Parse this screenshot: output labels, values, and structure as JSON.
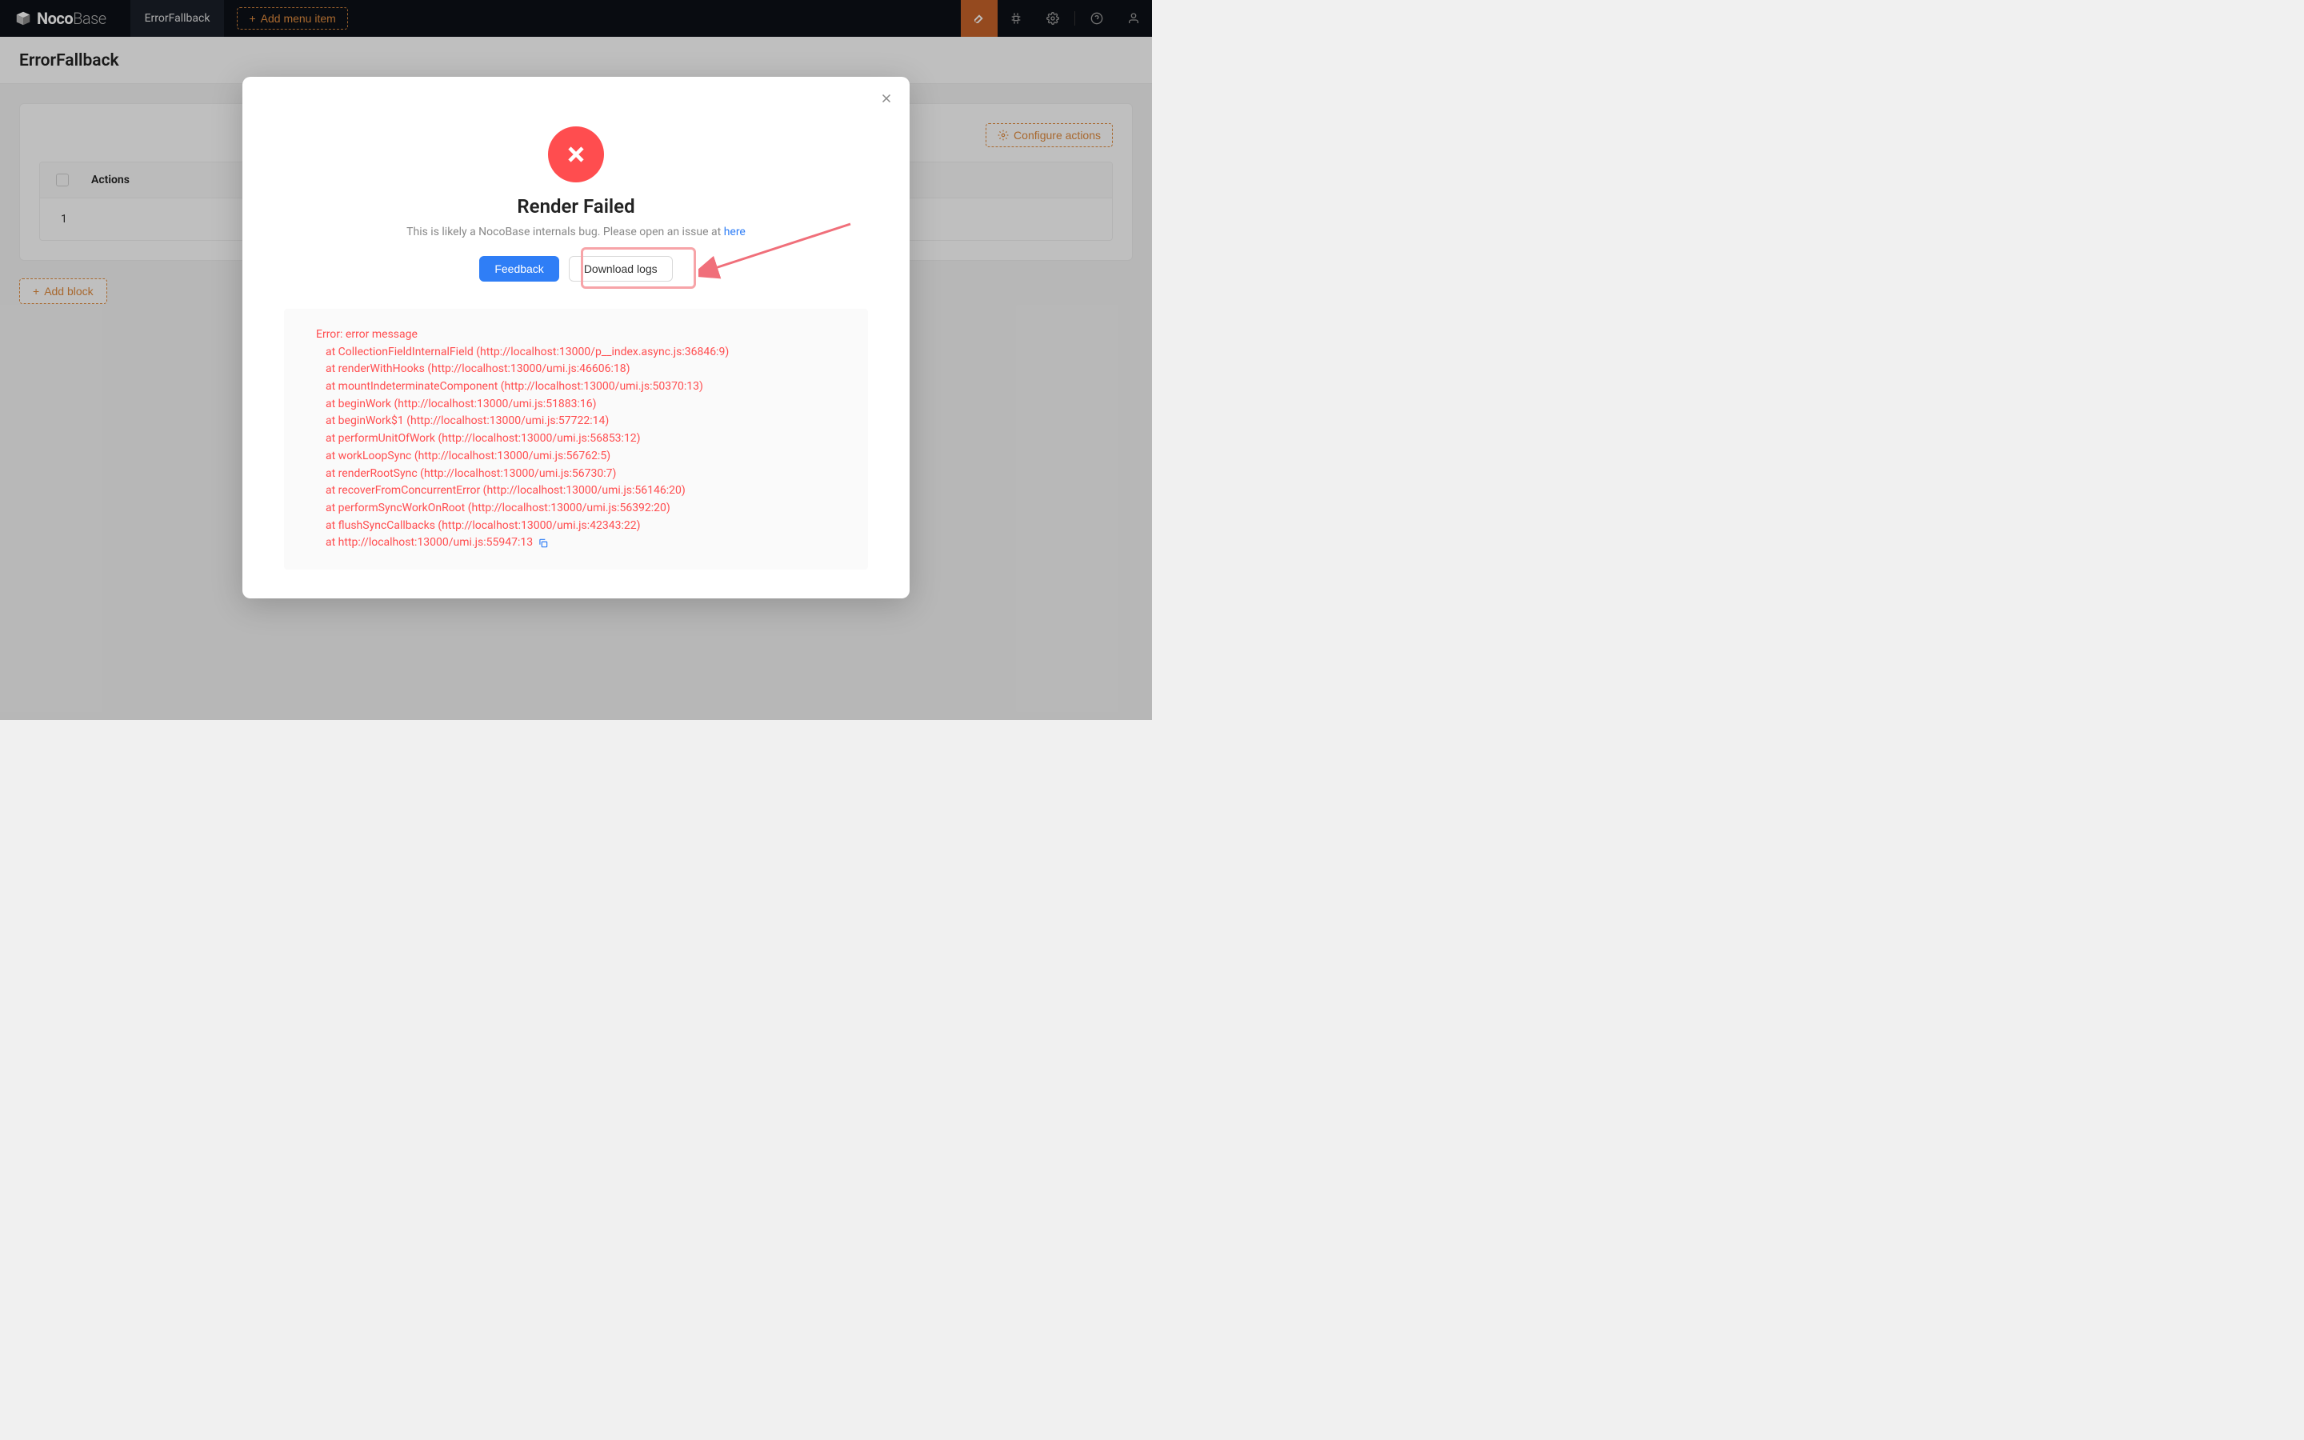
{
  "header": {
    "brand_bold": "Noco",
    "brand_light": "Base",
    "nav_item": "ErrorFallback",
    "add_menu": "Add menu item"
  },
  "page": {
    "title": "ErrorFallback",
    "configure_actions": "Configure actions",
    "actions_col": "Actions",
    "row_num": "1",
    "add_block": "Add block"
  },
  "modal": {
    "title": "Render Failed",
    "desc_prefix": "This is likely a NocoBase internals bug. Please open an issue at ",
    "desc_link": "here",
    "feedback": "Feedback",
    "download_logs": "Download logs",
    "stack": [
      "Error: error message",
      "at CollectionFieldInternalField (http://localhost:13000/p__index.async.js:36846:9)",
      "at renderWithHooks (http://localhost:13000/umi.js:46606:18)",
      "at mountIndeterminateComponent (http://localhost:13000/umi.js:50370:13)",
      "at beginWork (http://localhost:13000/umi.js:51883:16)",
      "at beginWork$1 (http://localhost:13000/umi.js:57722:14)",
      "at performUnitOfWork (http://localhost:13000/umi.js:56853:12)",
      "at workLoopSync (http://localhost:13000/umi.js:56762:5)",
      "at renderRootSync (http://localhost:13000/umi.js:56730:7)",
      "at recoverFromConcurrentError (http://localhost:13000/umi.js:56146:20)",
      "at performSyncWorkOnRoot (http://localhost:13000/umi.js:56392:20)",
      "at flushSyncCallbacks (http://localhost:13000/umi.js:42343:22)",
      "at http://localhost:13000/umi.js:55947:13"
    ]
  }
}
